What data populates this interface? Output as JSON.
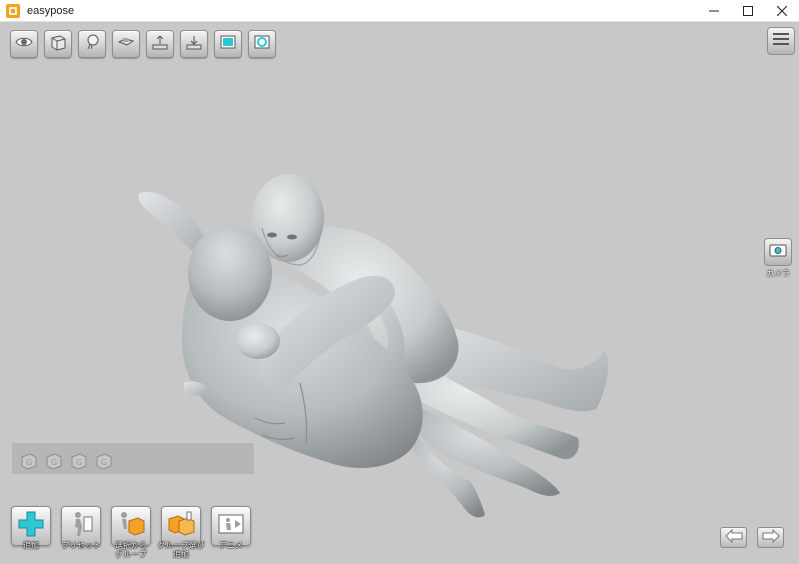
{
  "window": {
    "title": "easypose",
    "controls": [
      "minimize",
      "maximize",
      "close"
    ]
  },
  "toolbar": {
    "buttons": [
      {
        "name": "eye-icon"
      },
      {
        "name": "cube-icon"
      },
      {
        "name": "light-bulb-icon"
      },
      {
        "name": "floor-icon"
      },
      {
        "name": "export-icon"
      },
      {
        "name": "import-icon"
      },
      {
        "name": "background-icon"
      },
      {
        "name": "texture-icon"
      }
    ]
  },
  "camera": {
    "label": "カメラ"
  },
  "group_tray": {
    "slot_glyph": "G",
    "slots": 4
  },
  "bottom_bar": {
    "add_label": "追加",
    "preset_label": "プリセット",
    "save_group_label": "選択から\nグループ",
    "load_group_label": "グループ選び\n追加",
    "anim_label": "アニメ"
  },
  "colors": {
    "viewport_bg": "#c8c8c8",
    "accent_cyan": "#2ec7d6",
    "accent_orange": "#f3a12a",
    "figure_light": "#dfe3e4",
    "figure_shadow": "#9aa0a3"
  }
}
